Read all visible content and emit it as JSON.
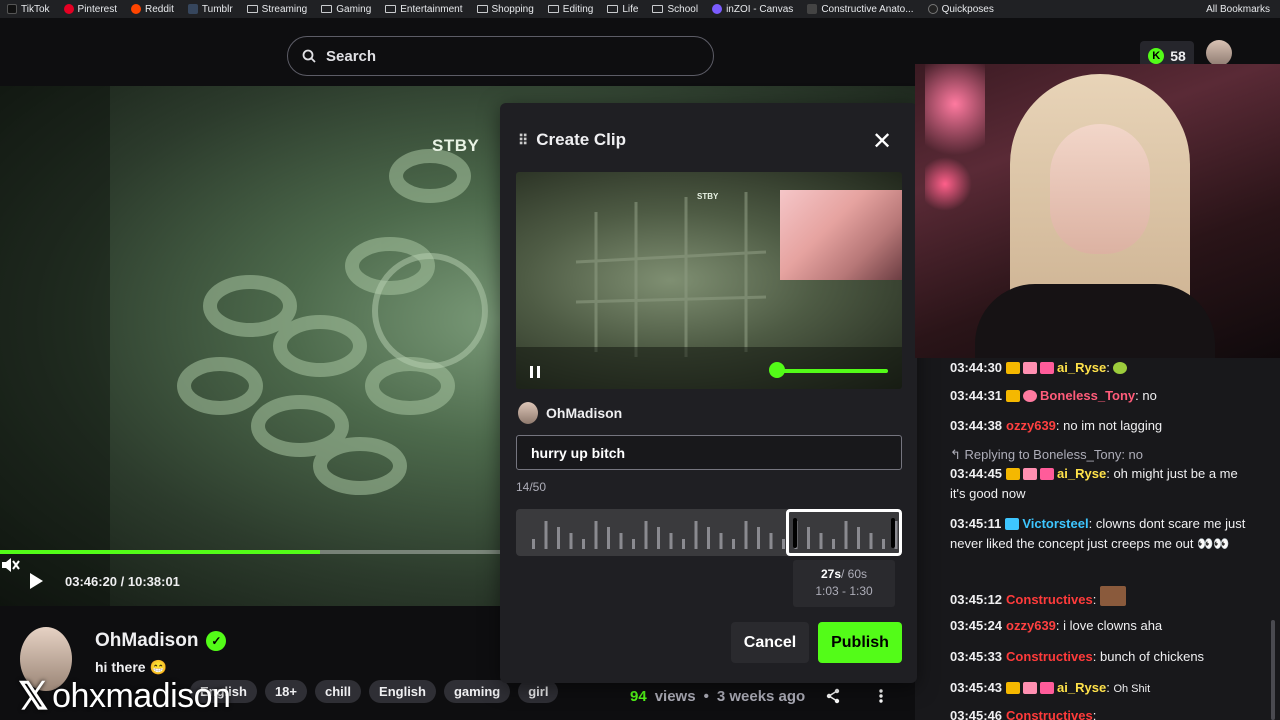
{
  "bookmarks": {
    "items": [
      {
        "label": "TikTok",
        "icon": "tiktok-icon",
        "color": "#000000"
      },
      {
        "label": "Pinterest",
        "icon": "pinterest-icon",
        "color": "#e60023"
      },
      {
        "label": "Reddit",
        "icon": "reddit-icon",
        "color": "#ff4500"
      },
      {
        "label": "Tumblr",
        "icon": "tumblr-icon",
        "color": "#36465d"
      },
      {
        "label": "Streaming",
        "icon": "folder-icon"
      },
      {
        "label": "Gaming",
        "icon": "folder-icon"
      },
      {
        "label": "Entertainment",
        "icon": "folder-icon"
      },
      {
        "label": "Shopping",
        "icon": "folder-icon"
      },
      {
        "label": "Editing",
        "icon": "folder-icon"
      },
      {
        "label": "Life",
        "icon": "folder-icon"
      },
      {
        "label": "School",
        "icon": "folder-icon"
      },
      {
        "label": "inZOI - Canvas",
        "icon": "inzoi-icon",
        "color": "#7b5cff"
      },
      {
        "label": "Constructive Anato...",
        "icon": "bookmark-icon",
        "color": "#444444"
      },
      {
        "label": "Quickposes",
        "icon": "quickposes-icon",
        "color": "#222222"
      }
    ],
    "all_label": "All Bookmarks"
  },
  "header": {
    "search_placeholder": "Search",
    "kick_count": "58"
  },
  "player": {
    "overlay_text": "STBY",
    "time": "03:46:20 / 10:38:01",
    "progress": 0.35
  },
  "channel": {
    "name": "OhMadison",
    "bio": "hi there 😁",
    "tags": [
      "English",
      "18+",
      "chill",
      "English",
      "gaming",
      "girl"
    ],
    "watermark": "ohxmadison",
    "views_count": "94",
    "views_label": "views",
    "age": "3 weeks ago"
  },
  "clip_modal": {
    "title": "Create Clip",
    "preview_text": "STBY",
    "username": "OhMadison",
    "title_value": "hurry up bitch",
    "counter": "14/50",
    "duration": "27s",
    "duration_max": "/ 60s",
    "range": "1:03 - 1:30",
    "cancel_label": "Cancel",
    "publish_label": "Publish"
  },
  "chat": {
    "messages": [
      {
        "time": "03:44:30",
        "user": "ai_Ryse",
        "color": "#ffe24a",
        "text": ""
      },
      {
        "time": "03:44:31",
        "user": "Boneless_Tony",
        "color": "#ff5c7a",
        "text": "no"
      },
      {
        "time": "03:44:38",
        "user": "ozzy639",
        "color": "#ff4040",
        "text": "no im not lagging"
      },
      {
        "reply": "Replying to Boneless_Tony: no"
      },
      {
        "time": "03:44:45",
        "user": "ai_Ryse",
        "color": "#ffe24a",
        "text": "oh might just be a me it's good now"
      },
      {
        "time": "03:45:11",
        "user": "Victorsteel",
        "color": "#3ec6ff",
        "text": "clowns dont scare me just never liked the concept just creeps me out 👀👀"
      },
      {
        "time": "03:45:12",
        "user": "Constructives",
        "color": "#ff3b3b",
        "text": ""
      },
      {
        "time": "03:45:24",
        "user": "ozzy639",
        "color": "#ff4040",
        "text": "i love clowns aha"
      },
      {
        "time": "03:45:33",
        "user": "Constructives",
        "color": "#ff3b3b",
        "text": "bunch of chickens"
      },
      {
        "time": "03:45:43",
        "user": "ai_Ryse",
        "color": "#ffe24a",
        "text": "Oh Shit"
      },
      {
        "time": "03:45:46",
        "user": "Constructives",
        "color": "#ff3b3b",
        "text": ""
      }
    ]
  },
  "colors": {
    "accent": "#53fc18",
    "bg": "#0e0e10",
    "panel": "#1f1f23"
  }
}
